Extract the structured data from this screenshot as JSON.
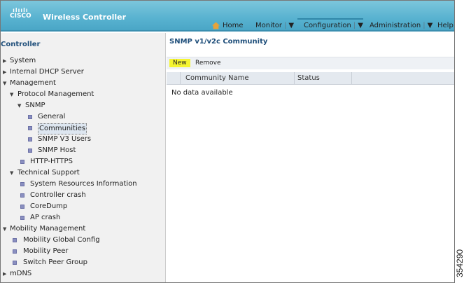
{
  "header": {
    "logo": "cisco",
    "app_title": "Wireless Controller",
    "nav": [
      {
        "label": "Home"
      },
      {
        "label": "Monitor"
      },
      {
        "label": "Configuration"
      },
      {
        "label": "Administration"
      },
      {
        "label": "Help"
      }
    ]
  },
  "sidebar": {
    "title": "Controller",
    "items": [
      {
        "label": "System"
      },
      {
        "label": "Internal DHCP Server"
      },
      {
        "label": "Management"
      },
      {
        "label": "Protocol Management"
      },
      {
        "label": "SNMP"
      },
      {
        "label": "General"
      },
      {
        "label": "Communities"
      },
      {
        "label": "SNMP V3 Users"
      },
      {
        "label": "SNMP Host"
      },
      {
        "label": "HTTP-HTTPS"
      },
      {
        "label": "Technical Support"
      },
      {
        "label": "System Resources Information"
      },
      {
        "label": "Controller crash"
      },
      {
        "label": "CoreDump"
      },
      {
        "label": "AP crash"
      },
      {
        "label": "Mobility Management"
      },
      {
        "label": "Mobility Global Config"
      },
      {
        "label": "Mobility Peer"
      },
      {
        "label": "Switch Peer Group"
      },
      {
        "label": "mDNS"
      }
    ]
  },
  "main": {
    "title": "SNMP v1/v2c Community",
    "new_label": "New",
    "remove_label": "Remove",
    "columns": [
      "Community Name",
      "Status"
    ],
    "empty_text": "No data available"
  },
  "figure_number": "354290"
}
